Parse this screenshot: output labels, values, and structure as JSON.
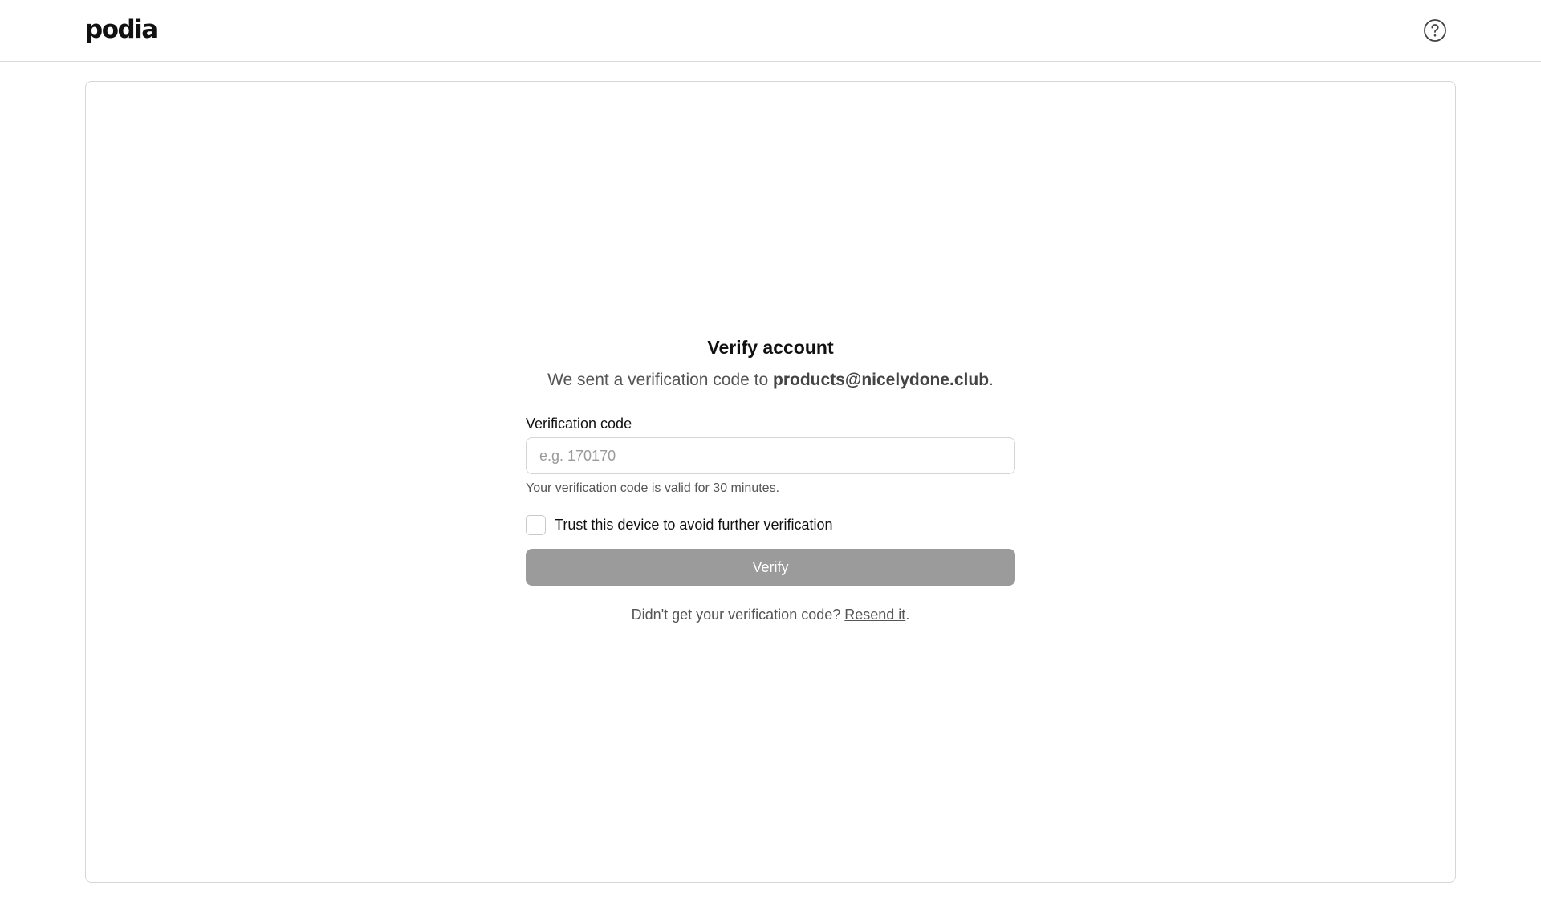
{
  "header": {
    "logo_text": "podia",
    "help_icon": "question-circle-icon"
  },
  "verify": {
    "title": "Verify account",
    "subtitle_prefix": "We sent a verification code to ",
    "email": "products@nicelydone.club",
    "subtitle_suffix": ".",
    "code_label": "Verification code",
    "code_placeholder": "e.g. 170170",
    "code_value": "",
    "code_help": "Your verification code is valid for 30 minutes.",
    "trust_label": "Trust this device to avoid further verification",
    "trust_checked": false,
    "verify_button": "Verify",
    "resend_prefix": "Didn't get your verification code? ",
    "resend_link": "Resend it",
    "resend_suffix": "."
  },
  "colors": {
    "button_disabled_bg": "#9b9b9c",
    "border": "#d6d6d6",
    "muted_text": "#555555"
  }
}
